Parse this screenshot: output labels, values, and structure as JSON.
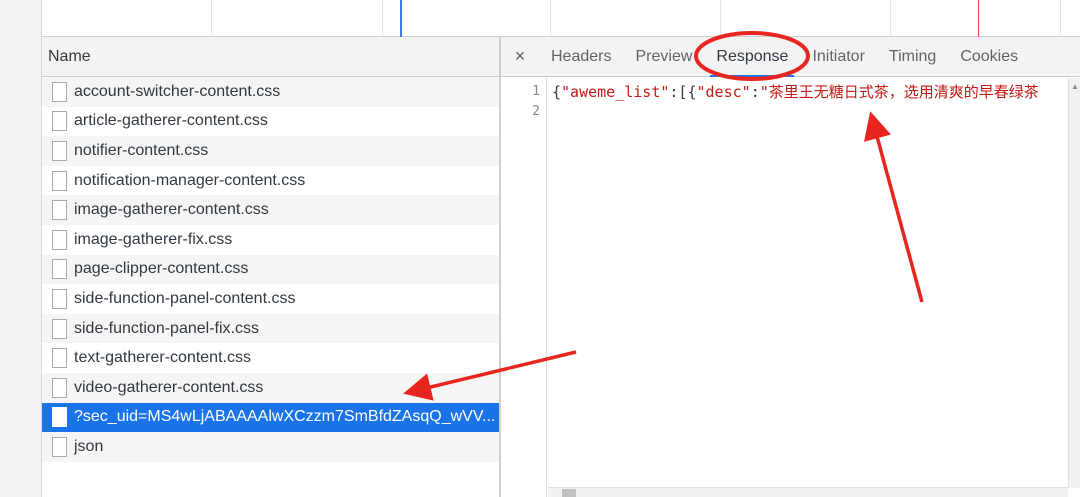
{
  "list": {
    "header": "Name",
    "rows": [
      {
        "label": "account-switcher-content.css"
      },
      {
        "label": "article-gatherer-content.css"
      },
      {
        "label": "notifier-content.css"
      },
      {
        "label": "notification-manager-content.css"
      },
      {
        "label": "image-gatherer-content.css"
      },
      {
        "label": "image-gatherer-fix.css"
      },
      {
        "label": "page-clipper-content.css"
      },
      {
        "label": "side-function-panel-content.css"
      },
      {
        "label": "side-function-panel-fix.css"
      },
      {
        "label": "text-gatherer-content.css"
      },
      {
        "label": "video-gatherer-content.css"
      },
      {
        "label": "?sec_uid=MS4wLjABAAAAlwXCzzm7SmBfdZAsqQ_wVV...",
        "selected": true
      },
      {
        "label": "json"
      }
    ]
  },
  "detail": {
    "close": "×",
    "tabs": [
      {
        "label": "Headers"
      },
      {
        "label": "Preview"
      },
      {
        "label": "Response",
        "active": true
      },
      {
        "label": "Initiator"
      },
      {
        "label": "Timing"
      },
      {
        "label": "Cookies"
      }
    ],
    "line_numbers": [
      "1",
      "2"
    ],
    "code": {
      "p1": "{",
      "k1": "\"aweme_list\"",
      "p2": ":[{",
      "k2": "\"desc\"",
      "p3": ":",
      "v1": "\"茶里王无糖日式茶，选用清爽的早春绿茶"
    }
  },
  "colors": {
    "accent": "#1a73e8",
    "annotation": "#e8251f",
    "string": "#c41a16"
  }
}
